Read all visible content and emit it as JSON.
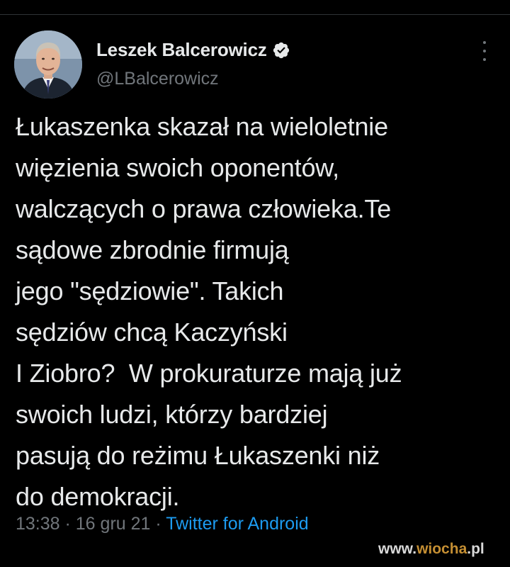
{
  "tweet": {
    "author": {
      "display_name": "Leszek Balcerowicz",
      "handle": "@LBalcerowicz",
      "verified": true,
      "avatar_icon": "profile-photo-icon"
    },
    "text_lines": [
      "Łukaszenka skazał na wieloletnie",
      "więzienia swoich oponentów,",
      "walczących o prawa człowieka.Te",
      "sądowe zbrodnie firmują",
      "jego \"sędziowie\". Takich",
      "sędziów chcą Kaczyński",
      "I Ziobro?  W prokuraturze mają już",
      "swoich ludzi, którzy bardziej",
      "pasują do reżimu Łukaszenki niż",
      "do demokracji."
    ],
    "time": "13:38",
    "date": "16 gru 21",
    "separator": " · ",
    "source": "Twitter for Android",
    "more_icon": "more-vertical-icon"
  },
  "watermark": {
    "prefix": "www.",
    "brand": "wiocha",
    "suffix": ".pl"
  },
  "colors": {
    "background": "#000000",
    "text": "#e7e9ea",
    "secondary": "#71767b",
    "link": "#1d9bf0",
    "watermark_accent": "#e8a93d"
  }
}
